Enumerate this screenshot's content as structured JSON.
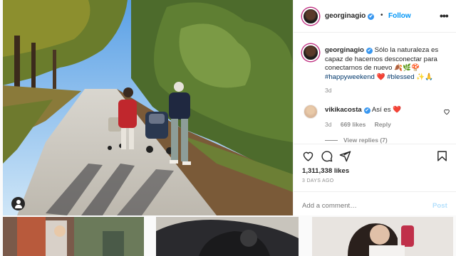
{
  "header": {
    "username": "georginagio",
    "verified_mark": "✔",
    "separator": "•",
    "follow_label": "Follow",
    "more_label": "•••"
  },
  "caption": {
    "username": "georginagio",
    "verified_mark": "✔",
    "text": "Sólo la naturaleza es capaz de hacernos desconectar para conectarnos de nuevo 🍂🌿🍄",
    "hashtag1": "#happyweekend",
    "heart": "❤️",
    "hashtag2": "#blessed",
    "emoji_tail": "✨🙏",
    "time": "3d"
  },
  "comment": {
    "username": "vikikacosta",
    "verified_mark": "✔",
    "text": "Así es ❤️",
    "time": "3d",
    "likes": "669 likes",
    "reply_label": "Reply",
    "view_replies": "View replies (7)"
  },
  "post": {
    "likes": "1,311,338 likes",
    "date": "3 DAYS AGO",
    "comment_placeholder": "Add a comment…",
    "post_label": "Post"
  },
  "colors": {
    "accent": "#0095f6",
    "verified": "#3897f0",
    "muted": "#8e8e8e",
    "post_disabled": "#b2dffc"
  },
  "icons": [
    "heart-icon",
    "comment-icon",
    "share-icon",
    "bookmark-icon",
    "user-tag-icon",
    "more-icon"
  ]
}
